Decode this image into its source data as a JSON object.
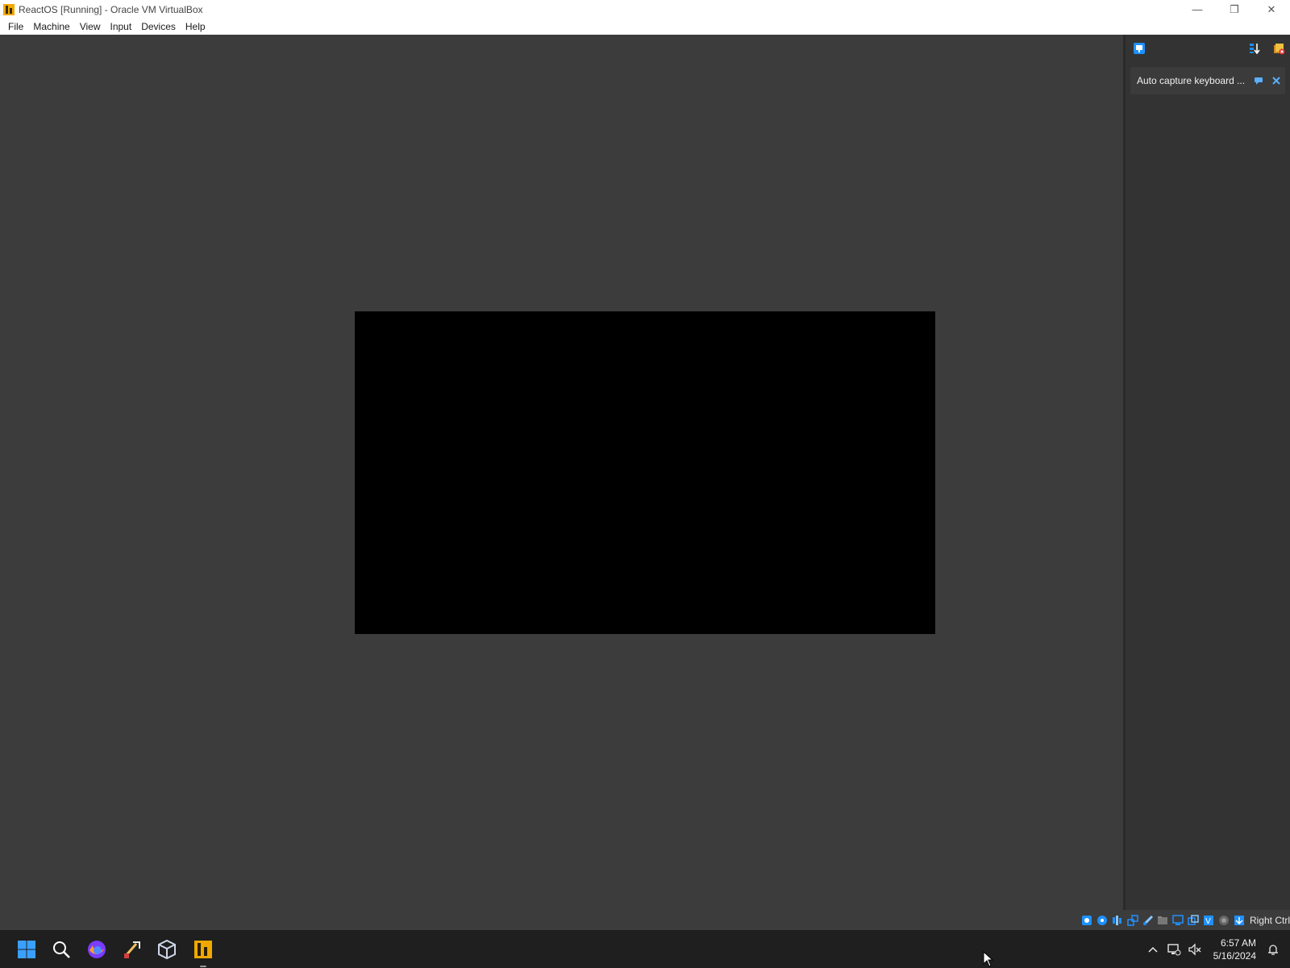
{
  "window": {
    "title": "ReactOS [Running] - Oracle VM VirtualBox",
    "controls": {
      "minimize": "—",
      "restore": "❐",
      "close": "✕"
    }
  },
  "menubar": {
    "items": [
      {
        "label": "File"
      },
      {
        "label": "Machine"
      },
      {
        "label": "View"
      },
      {
        "label": "Input"
      },
      {
        "label": "Devices"
      },
      {
        "label": "Help"
      }
    ]
  },
  "notification_center": {
    "messages": [
      {
        "text": "Auto capture keyboard ..."
      }
    ]
  },
  "statusbar": {
    "host_key": "Right Ctrl",
    "icons": [
      "hard-disk-icon",
      "optical-drive-icon",
      "audio-icon",
      "network-icon",
      "usb-icon",
      "shared-folders-icon",
      "display-icon",
      "recording-icon",
      "virtualization-icon",
      "cpu-icon",
      "mouse-integration-icon",
      "keyboard-capture-icon"
    ]
  },
  "taskbar": {
    "apps": [
      "start-icon",
      "search-icon",
      "firefox-icon",
      "tools-icon",
      "virtualbox-icon",
      "reactos-vm-icon"
    ],
    "clock": {
      "time": "6:57 AM",
      "date": "5/16/2024"
    }
  },
  "colors": {
    "vm_background": "#3c3c3c",
    "vm_screen": "#000000",
    "panel_background": "#333333",
    "taskbar_background": "#1f1f1f",
    "accent_blue": "#1e90ff"
  }
}
